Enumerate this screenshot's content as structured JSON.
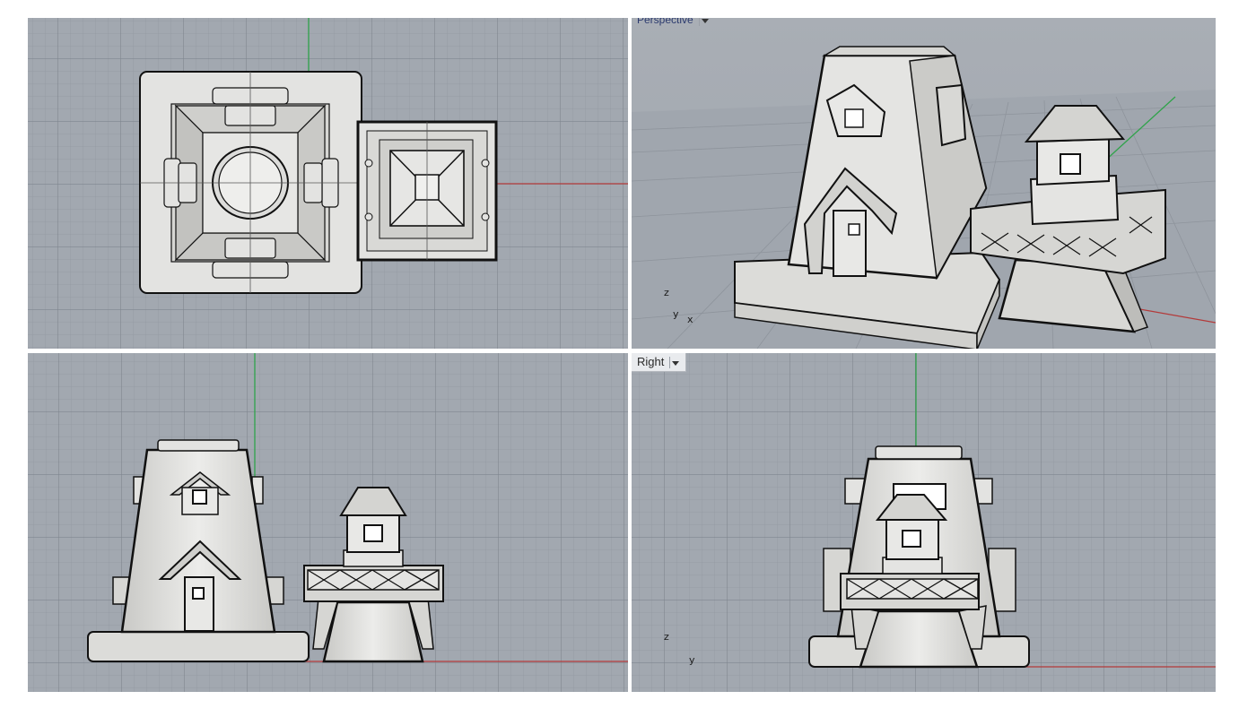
{
  "viewports": {
    "top": {
      "label": ""
    },
    "perspective": {
      "label": "Perspective",
      "axis": {
        "z": "z",
        "y": "y",
        "x": "x"
      }
    },
    "front": {
      "label": ""
    },
    "right": {
      "label": "Right",
      "axis": {
        "z": "z",
        "y": "y"
      }
    }
  },
  "colors": {
    "background": "#a2a8b0",
    "grid_minor": "#9299a2",
    "grid_major": "#7d848d",
    "x_axis": "#b33a3a",
    "y_axis": "#2fa34a",
    "model_fill": "#e3e3e1",
    "model_edge": "#111111"
  }
}
